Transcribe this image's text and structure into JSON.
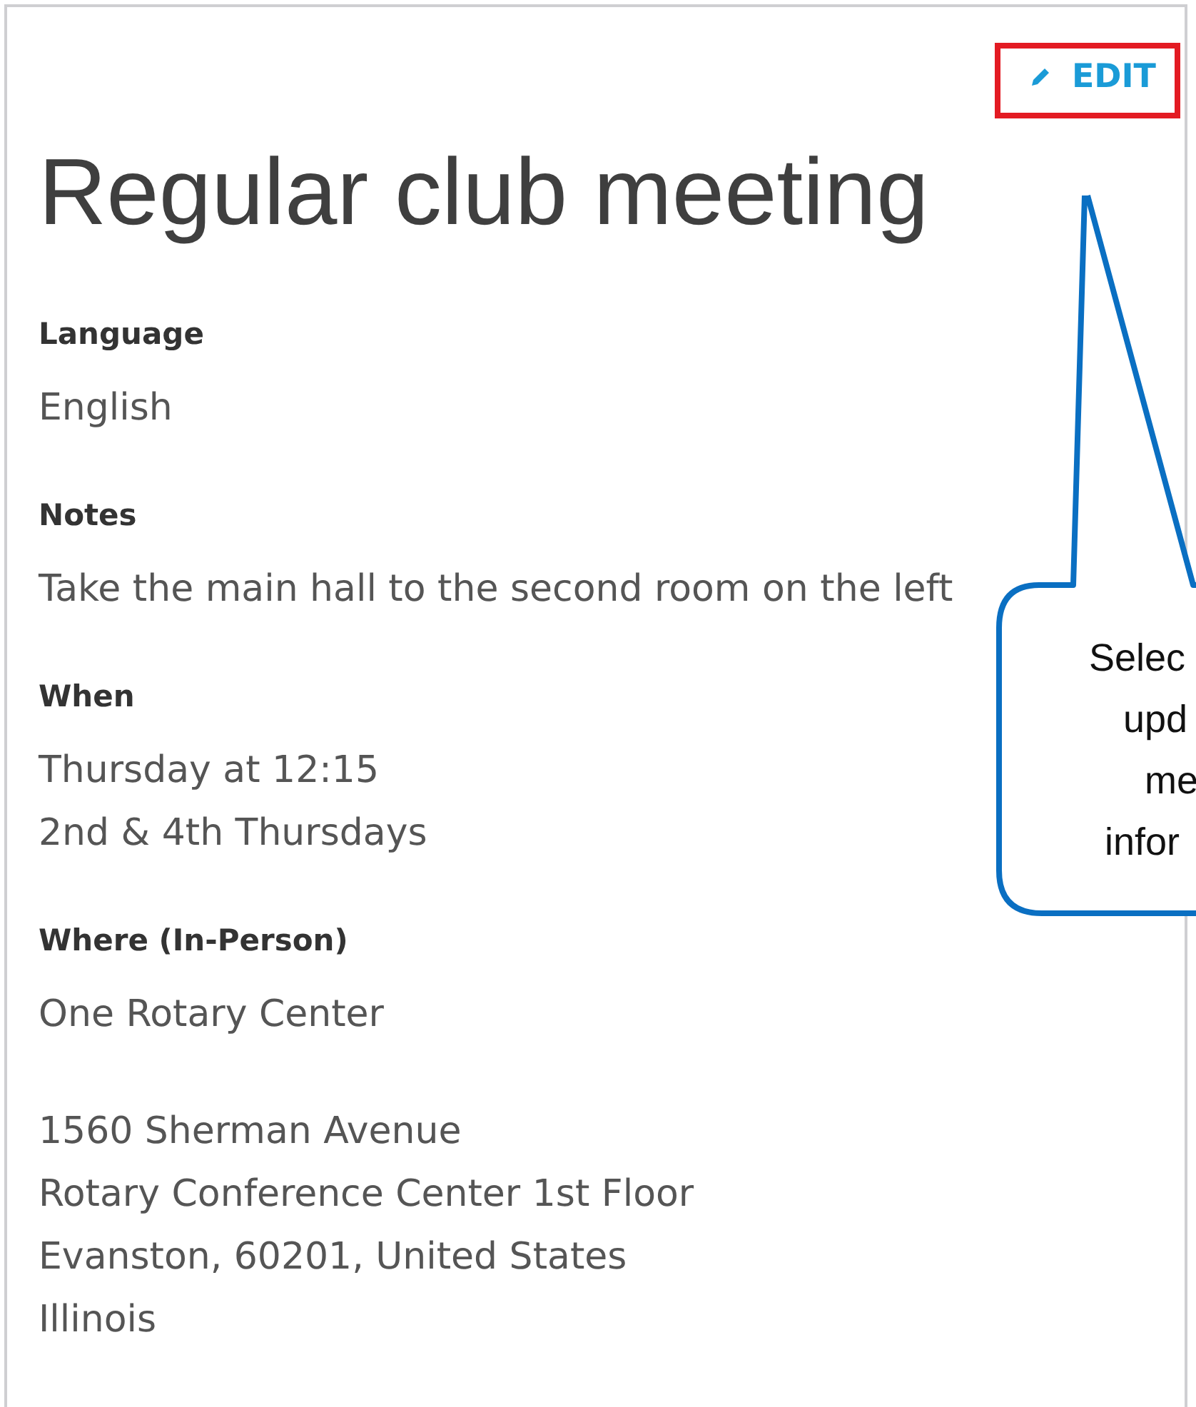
{
  "card": {
    "edit_button": {
      "label": "EDIT",
      "highlighted": true
    },
    "title": "Regular club meeting",
    "sections": [
      {
        "label": "Language",
        "lines": [
          "English"
        ]
      },
      {
        "label": "Notes",
        "lines": [
          "Take the main hall to the second room on the left"
        ]
      },
      {
        "label": "When",
        "lines": [
          "Thursday at 12:15",
          "2nd & 4th Thursdays"
        ]
      },
      {
        "label": "Where (In-Person)",
        "lines": [
          "One Rotary Center"
        ]
      },
      {
        "lines": [
          "1560 Sherman Avenue",
          "Rotary Conference Center 1st Floor",
          "Evanston, 60201, United States",
          "Illinois"
        ]
      }
    ]
  },
  "callout": {
    "lines": [
      "Selec",
      "upd",
      "me",
      "infor"
    ]
  }
}
